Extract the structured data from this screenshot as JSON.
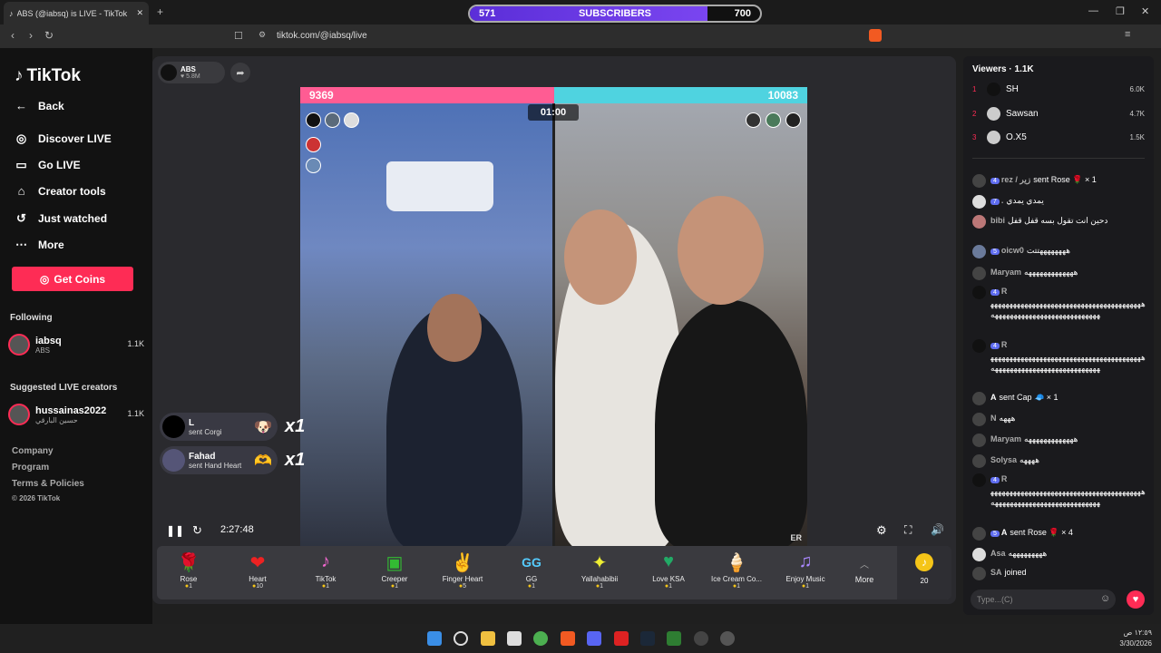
{
  "browser": {
    "tab_title": "ABS (@iabsq) is LIVE - TikTok",
    "url": "tiktok.com/@iabsq/live",
    "overlay": {
      "left": "571",
      "label": "SUBSCRIBERS",
      "right": "700",
      "progress": 0.82
    }
  },
  "sidebar": {
    "logo": "TikTok",
    "nav": [
      {
        "label": "Back",
        "icon": "back-arrow-icon"
      },
      {
        "label": "Discover LIVE",
        "icon": "live-icon"
      },
      {
        "label": "Go LIVE",
        "icon": "camera-icon"
      },
      {
        "label": "Creator tools",
        "icon": "home-icon"
      },
      {
        "label": "Just watched",
        "icon": "history-icon"
      },
      {
        "label": "More",
        "icon": "more-icon"
      }
    ],
    "get_coins": "Get Coins",
    "following_title": "Following",
    "following": {
      "name": "iabsq",
      "sub": "ABS",
      "count": "1.1K"
    },
    "suggested_title": "Suggested LIVE creators",
    "suggested": {
      "name": "hussainas2022",
      "sub": "حسين البارقي",
      "count": "1.1K"
    },
    "footer": [
      "Company",
      "Program",
      "Terms & Policies",
      "© 2026 TikTok"
    ]
  },
  "stream": {
    "host_name": "ABS",
    "host_likes": "♥ 5.8M",
    "score_left": "9369",
    "score_right": "10083",
    "timer": "01:00",
    "watermark": "ER",
    "elapsed": "2:27:48",
    "gift_notes": [
      {
        "user": "L",
        "text": "sent Corgi",
        "count": "x1"
      },
      {
        "user": "Fahad",
        "text": "sent Hand Heart",
        "count": "x1"
      }
    ]
  },
  "gifts": [
    {
      "name": "Rose",
      "price": "1",
      "icon": "🌹"
    },
    {
      "name": "Heart",
      "price": "10",
      "icon": "❤"
    },
    {
      "name": "TikTok",
      "price": "1",
      "icon": "♪"
    },
    {
      "name": "Creeper",
      "price": "1",
      "icon": "▣"
    },
    {
      "name": "Finger Heart",
      "price": "5",
      "icon": "✌"
    },
    {
      "name": "GG",
      "price": "1",
      "icon": "GG"
    },
    {
      "name": "Yallahabibii",
      "price": "1",
      "icon": "✦"
    },
    {
      "name": "Love KSA",
      "price": "1",
      "icon": "♥"
    },
    {
      "name": "Ice Cream Co...",
      "price": "1",
      "icon": "🍦"
    },
    {
      "name": "Enjoy Music",
      "price": "1",
      "icon": "♫"
    }
  ],
  "gift_more": "More",
  "coin_count": "20",
  "chat": {
    "viewers_title": "Viewers · 1.1K",
    "viewers": [
      {
        "rank": "1",
        "name": "SH",
        "score": "6.0K"
      },
      {
        "rank": "2",
        "name": "Sawsan",
        "score": "4.7K"
      },
      {
        "rank": "3",
        "name": "O.X5",
        "score": "1.5K"
      }
    ],
    "messages": [
      {
        "badge": "4",
        "who": "rez / زير",
        "text": "sent Rose 🌹 × 1"
      },
      {
        "badge": "7",
        "who": ".",
        "text": "يمدي يمدي"
      },
      {
        "badge": "",
        "who": "bibi",
        "text": "دحين انت تقول بسه قفل قفل"
      },
      {
        "badge": "5",
        "who": "oicw0",
        "text": "ههههههههتتت"
      },
      {
        "badge": "",
        "who": "Maryam",
        "text": "هههههههههههههه"
      },
      {
        "badge": "4",
        "who": "R",
        "text": "هههههههههههههههههههههههههههههههههههههههههههههههههههههههههههههههههههههه"
      },
      {
        "badge": "4",
        "who": "R",
        "text": "هههههههههههههههههههههههههههههههههههههههههههههههههههههههههههههههههههههه"
      },
      {
        "badge": "",
        "who": "A",
        "text": "sent Cap 🧢 × 1"
      },
      {
        "badge": "",
        "who": "N",
        "text": "هههه"
      },
      {
        "badge": "",
        "who": "Maryam",
        "text": "هههههههههههههه"
      },
      {
        "badge": "",
        "who": "Solysa",
        "text": "ههههه"
      },
      {
        "badge": "4",
        "who": "R",
        "text": "هههههههههههههههههههههههههههههههههههههههههههههههههههههههههههههههههههههه"
      },
      {
        "badge": "5",
        "who": "A",
        "text": "sent Rose 🌹 × 4"
      },
      {
        "badge": "",
        "who": "Asa",
        "text": "هههههههههه"
      },
      {
        "badge": "",
        "who": "SA",
        "text": "joined"
      }
    ],
    "input_placeholder": "Type...(C)"
  },
  "taskbar": {
    "time": "١٢:٥٩ ص",
    "date": "3/30/2026"
  }
}
